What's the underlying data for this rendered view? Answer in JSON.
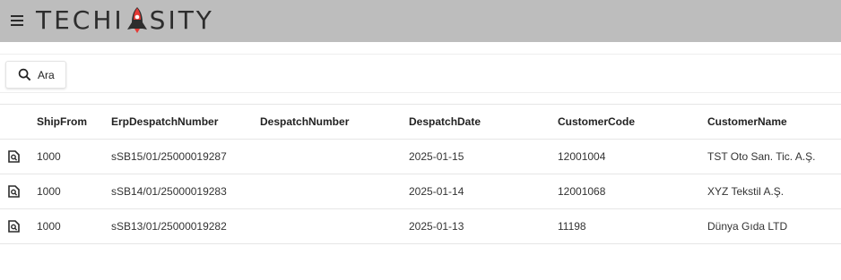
{
  "app": {
    "logo_part1": "TECHI",
    "logo_part2": "SITY"
  },
  "toolbar": {
    "search_label": "Ara"
  },
  "table": {
    "columns": [
      "ShipFrom",
      "ErpDespatchNumber",
      "DespatchNumber",
      "DespatchDate",
      "CustomerCode",
      "CustomerName"
    ],
    "rows": [
      {
        "ship_from": "1000",
        "erp_despatch_number": "sSB15/01/25000019287",
        "despatch_number": "",
        "despatch_date": "2025-01-15",
        "customer_code": "12001004",
        "customer_name": "TST Oto San. Tic. A.Ş."
      },
      {
        "ship_from": "1000",
        "erp_despatch_number": "sSB14/01/25000019283",
        "despatch_number": "",
        "despatch_date": "2025-01-14",
        "customer_code": "12001068",
        "customer_name": "XYZ Tekstil A.Ş."
      },
      {
        "ship_from": "1000",
        "erp_despatch_number": "sSB13/01/25000019282",
        "despatch_number": "",
        "despatch_date": "2025-01-13",
        "customer_code": "11198",
        "customer_name": "Dünya Gıda LTD"
      }
    ]
  },
  "icons": {
    "menu": "hamburger-menu-icon",
    "search": "search-icon",
    "row_action": "document-search-icon",
    "logo_mark": "rocket-icon"
  },
  "colors": {
    "topbar": "#bdbdbd",
    "logo_text": "#2d2d2d",
    "logo_accent": "#e53935"
  }
}
